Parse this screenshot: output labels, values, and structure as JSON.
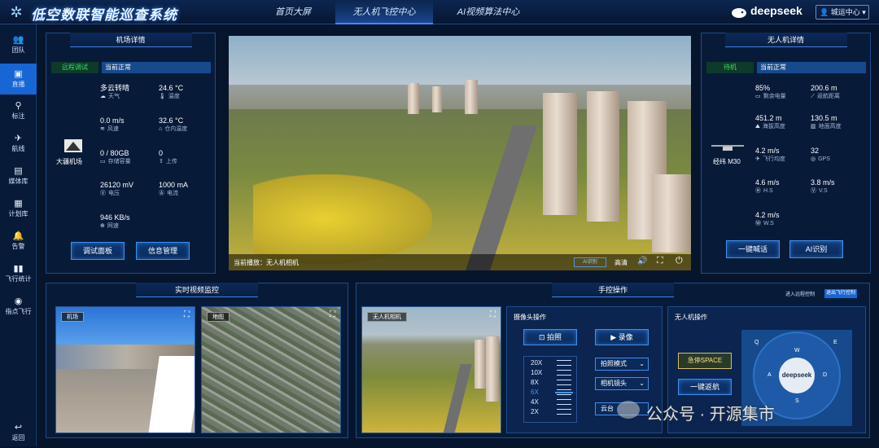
{
  "header": {
    "title": "低空数联智能巡查系统",
    "tabs": [
      {
        "label": "首页大屏"
      },
      {
        "label": "无人机飞控中心"
      },
      {
        "label": "AI视频算法中心"
      }
    ],
    "brand": "deepseek",
    "user": "城运中心"
  },
  "sidebar": {
    "items": [
      {
        "label": "团队",
        "icon": "team-icon"
      },
      {
        "label": "直播",
        "icon": "live-icon"
      },
      {
        "label": "标注",
        "icon": "marker-icon"
      },
      {
        "label": "航线",
        "icon": "route-icon"
      },
      {
        "label": "媒体库",
        "icon": "media-icon"
      },
      {
        "label": "计划库",
        "icon": "plan-icon"
      },
      {
        "label": "告警",
        "icon": "alarm-icon"
      },
      {
        "label": "飞行统计",
        "icon": "stats-icon"
      },
      {
        "label": "指点飞行",
        "icon": "point-icon"
      }
    ],
    "back": "返回"
  },
  "airport": {
    "title": "机场详情",
    "tag": "远程调试",
    "status": "当前正常",
    "name": "大疆机场",
    "stats": [
      {
        "value": "多云转晴",
        "label": "天气"
      },
      {
        "value": "24.6 °C",
        "label": "温度"
      },
      {
        "value": "0.0  m/s",
        "label": "风速"
      },
      {
        "value": "32.6 °C",
        "label": "仓内温度"
      },
      {
        "value": "0 / 80GB",
        "label": "存储容量"
      },
      {
        "value": "0",
        "label": "上传"
      },
      {
        "value": "26120 mV",
        "label": "电压"
      },
      {
        "value": "1000 mA",
        "label": "电流"
      },
      {
        "value": "946 KB/s",
        "label": "网速"
      }
    ],
    "buttons": [
      "调试面板",
      "信息管理"
    ]
  },
  "video": {
    "caption": "当前播放：无人机相机",
    "ai_label": "AI识别",
    "quality": "高清"
  },
  "drone": {
    "title": "无人机详情",
    "tag": "待机",
    "status": "当前正常",
    "name": "经纬 M30",
    "stats": [
      {
        "value": "85%",
        "label": "剩余电量"
      },
      {
        "value": "200.6 m",
        "label": "返航距离"
      },
      {
        "value": "451.2 m",
        "label": "海拔高度"
      },
      {
        "value": "130.5 m",
        "label": "地面高度"
      },
      {
        "value": "4.2  m/s",
        "label": "飞行均度"
      },
      {
        "value": "32",
        "label": "GPS"
      },
      {
        "value": "4.6 m/s",
        "label": "H.S"
      },
      {
        "value": "3.8 m/s",
        "label": "V.S"
      },
      {
        "value": "4.2 m/s",
        "label": "W.S"
      }
    ],
    "buttons": [
      "一键喊话",
      "AI识别"
    ]
  },
  "monitor": {
    "title": "实时视频监控",
    "thumbs": [
      "机场",
      "地图"
    ]
  },
  "control": {
    "title": "手控操作",
    "enter_remote": "进入远程控制",
    "exit_flight": "退出飞行控制",
    "cam_label": "无人机相机",
    "camera": {
      "title": "摄像头操作",
      "photo": "拍照",
      "record": "录像",
      "zoom": [
        "20X",
        "10X",
        "8X",
        "6X",
        "4X",
        "2X"
      ],
      "zoom_active": "6X",
      "mode": "拍照模式",
      "lens": "相机镜头",
      "gimbal": "云台"
    },
    "drone_ops": {
      "title": "无人机操作",
      "stop": "急停SPACE",
      "return": "一键返航",
      "keys": [
        "Q",
        "W",
        "E",
        "A",
        "D",
        "S"
      ],
      "center": "deepseek"
    }
  },
  "watermark": "公众号 · 开源集市"
}
